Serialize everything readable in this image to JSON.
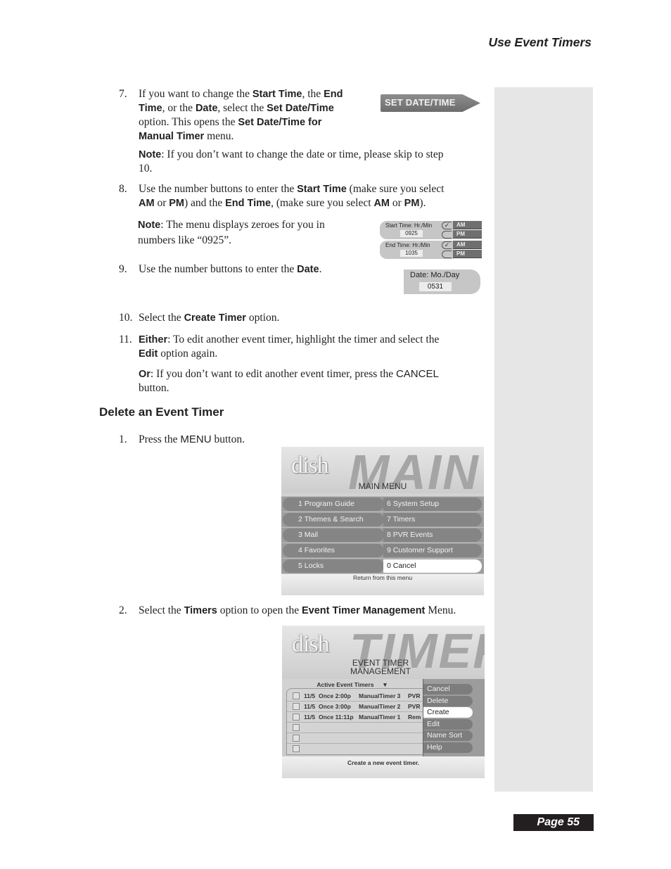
{
  "header": {
    "running_title": "Use Event Timers"
  },
  "footer": {
    "page_label": "Page 55"
  },
  "steps_part1": [
    {
      "number": "7.",
      "segments": [
        "If you want to change the ",
        "Start Time",
        ", the ",
        "End",
        " ",
        "Time",
        ", or the ",
        "Date",
        ", select the ",
        "Set Date/Time",
        " ",
        "option. This opens the ",
        "Set Date/Time for",
        " ",
        "Manual Timer",
        " menu."
      ],
      "note_label": "Note",
      "note_text": ": If you don’t want to change the date or time, please skip to step",
      "note_text2": "10."
    },
    {
      "number": "8.",
      "line1a": "Use the number buttons to enter the ",
      "line1b": "Start Time",
      "line1c": " (make sure you select",
      "line2a": "AM",
      "line2b": " or ",
      "line2c": "PM",
      "line2d": ") and the ",
      "line2e": "End Time",
      "line2f": ", (make sure you select ",
      "line2g": "AM",
      "line2h": " or ",
      "line2i": "PM",
      "line2j": ").",
      "note_label": "Note",
      "note_text": ": The menu displays zeroes for you in",
      "note_text2": "numbers like “0925”."
    },
    {
      "number": "9.",
      "text": "Use the number buttons to enter the ",
      "bold": "Date",
      "end": "."
    },
    {
      "number": "10.",
      "text": "Select the ",
      "bold": "Create Timer",
      "end": " option."
    },
    {
      "number": "11.",
      "either_label": "Either",
      "either_text": ": To edit another event timer, highlight the timer and select the",
      "edit_label": "Edit",
      "edit_text": " option again.",
      "or_label": "Or",
      "or_text": ": If you don’t want to edit another event timer, press the ",
      "cancel_word": "CANCEL",
      "or_text2": "button."
    }
  ],
  "set_date_button": {
    "label": "SET DATE/TIME"
  },
  "time_panel": {
    "start": {
      "label": "Start Time: Hr./Min",
      "value": "0925",
      "am": "AM",
      "pm": "PM",
      "selected": "AM"
    },
    "end": {
      "label": "End Time: Hr./Min",
      "value": "1035",
      "am": "AM",
      "pm": "PM",
      "selected": "AM"
    },
    "check_glyph": "✓"
  },
  "date_panel": {
    "label": "Date: Mo./Day",
    "value": "0531"
  },
  "section2": {
    "heading": "Delete an Event Timer",
    "step1": {
      "number": "1.",
      "text": "Press the ",
      "key": "MENU",
      "end": " button."
    },
    "step2": {
      "number": "2.",
      "text": "Select the ",
      "bold1": "Timers",
      "mid": " option to open the ",
      "bold2": "Event Timer Management",
      "end": " Menu."
    }
  },
  "main_menu_screen": {
    "logo": "dish",
    "big_word": "MAIN",
    "title": "MAIN MENU",
    "left_items": [
      "1 Program Guide",
      "2 Themes & Search",
      "3 Mail",
      "4 Favorites",
      "5 Locks"
    ],
    "right_items": [
      "6 System Setup",
      "7 Timers",
      "8 PVR Events",
      "9 Customer Support",
      "0  Cancel"
    ],
    "selected": "0  Cancel",
    "footer": "Return from this menu"
  },
  "timer_screen": {
    "logo": "dish",
    "big_word": "TIMER",
    "title_line1": "EVENT TIMER",
    "title_line2": "MANAGEMENT",
    "list_header": "Active Event Timers",
    "list_header_arrow": "▼",
    "rows": [
      {
        "date": "11/5",
        "freq": "Once 2:00p",
        "name": "ManualTimer 3",
        "type": "PVR"
      },
      {
        "date": "11/5",
        "freq": "Once 3:00p",
        "name": "ManualTimer 2",
        "type": "PVR"
      },
      {
        "date": "11/5",
        "freq": "Once 11:11p",
        "name": "ManualTimer 1",
        "type": "Rem"
      },
      {
        "date": "",
        "freq": "",
        "name": "",
        "type": ""
      },
      {
        "date": "",
        "freq": "",
        "name": "",
        "type": ""
      },
      {
        "date": "",
        "freq": "",
        "name": "",
        "type": ""
      }
    ],
    "buttons": [
      "Cancel",
      "Delete",
      "Create",
      "Edit",
      "Name Sort",
      "Help"
    ],
    "selected_button": "Create",
    "footer": "Create a new event timer."
  }
}
